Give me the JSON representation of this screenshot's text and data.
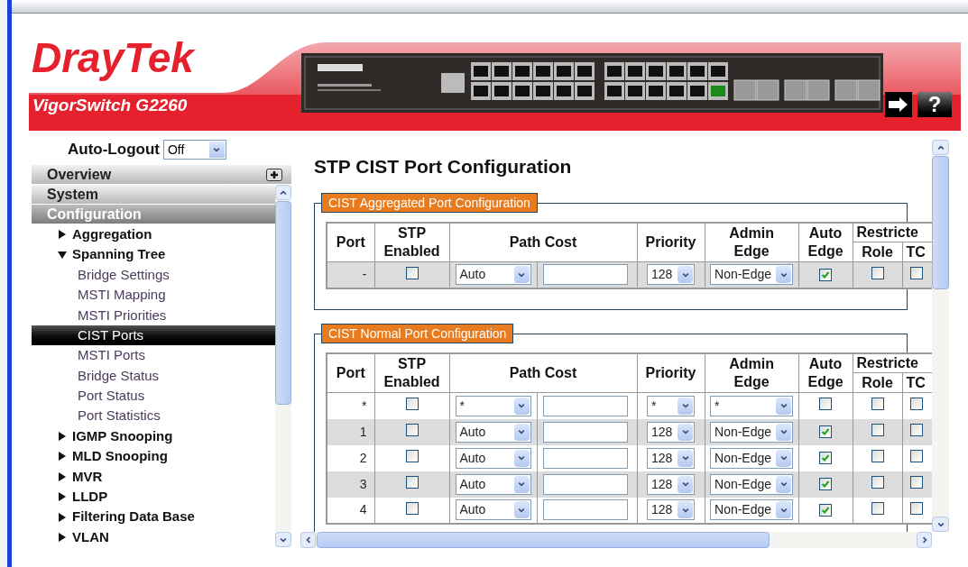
{
  "header": {
    "logo": "DrayTek",
    "model": "VigorSwitch G2260",
    "help_button": "?"
  },
  "sidebar": {
    "auto_logout": {
      "label": "Auto-Logout",
      "value": "Off"
    },
    "sections": [
      {
        "label": "Overview",
        "selected": false
      },
      {
        "label": "System",
        "selected": false
      },
      {
        "label": "Configuration",
        "selected": true
      }
    ],
    "tree": [
      {
        "label": "Aggregation",
        "expanded": false
      },
      {
        "label": "Spanning Tree",
        "expanded": true,
        "children": [
          {
            "label": "Bridge Settings",
            "selected": false
          },
          {
            "label": "MSTI Mapping",
            "selected": false
          },
          {
            "label": "MSTI Priorities",
            "selected": false
          },
          {
            "label": "CIST Ports",
            "selected": true
          },
          {
            "label": "MSTI Ports",
            "selected": false
          },
          {
            "label": "Bridge Status",
            "selected": false
          },
          {
            "label": "Port Status",
            "selected": false
          },
          {
            "label": "Port Statistics",
            "selected": false
          }
        ]
      },
      {
        "label": "IGMP Snooping",
        "expanded": false
      },
      {
        "label": "MLD Snooping",
        "expanded": false
      },
      {
        "label": "MVR",
        "expanded": false
      },
      {
        "label": "LLDP",
        "expanded": false
      },
      {
        "label": "Filtering Data Base",
        "expanded": false
      },
      {
        "label": "VLAN",
        "expanded": false
      }
    ]
  },
  "main": {
    "title": "STP CIST Port Configuration",
    "sections": [
      {
        "legend": "CIST Aggregated Port Configuration",
        "columns": {
          "port": "Port",
          "stp_enabled": "STP Enabled",
          "path_cost": "Path Cost",
          "priority": "Priority",
          "admin_edge": "Admin Edge",
          "auto_edge": "Auto Edge",
          "restricted": "Restricte",
          "role": "Role",
          "tc": "TC"
        },
        "rows": [
          {
            "port": "-",
            "stp_enabled": false,
            "path_cost": "Auto",
            "priority": "128",
            "admin_edge": "Non-Edge",
            "auto_edge": true,
            "role": false,
            "tc": false
          }
        ]
      },
      {
        "legend": "CIST Normal Port Configuration",
        "columns": {
          "port": "Port",
          "stp_enabled": "STP Enabled",
          "path_cost": "Path Cost",
          "priority": "Priority",
          "admin_edge": "Admin Edge",
          "auto_edge": "Auto Edge",
          "restricted": "Restricte",
          "role": "Role",
          "tc": "TC"
        },
        "rows": [
          {
            "port": "*",
            "stp_enabled": false,
            "path_cost": "*",
            "priority": "*",
            "admin_edge": "*",
            "auto_edge": false,
            "role": false,
            "tc": false
          },
          {
            "port": "1",
            "stp_enabled": false,
            "path_cost": "Auto",
            "priority": "128",
            "admin_edge": "Non-Edge",
            "auto_edge": true,
            "role": false,
            "tc": false
          },
          {
            "port": "2",
            "stp_enabled": false,
            "path_cost": "Auto",
            "priority": "128",
            "admin_edge": "Non-Edge",
            "auto_edge": true,
            "role": false,
            "tc": false
          },
          {
            "port": "3",
            "stp_enabled": false,
            "path_cost": "Auto",
            "priority": "128",
            "admin_edge": "Non-Edge",
            "auto_edge": true,
            "role": false,
            "tc": false
          },
          {
            "port": "4",
            "stp_enabled": false,
            "path_cost": "Auto",
            "priority": "128",
            "admin_edge": "Non-Edge",
            "auto_edge": true,
            "role": false,
            "tc": false
          }
        ]
      }
    ]
  }
}
